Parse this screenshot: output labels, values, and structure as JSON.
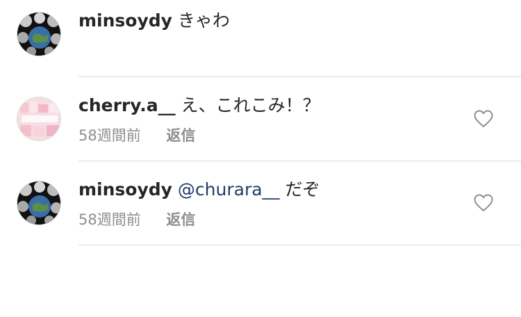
{
  "comments": [
    {
      "username": "minsoydy",
      "mention": "",
      "text": "きゃわ",
      "time": "",
      "reply": "",
      "avatar_icon": "earth-hands-avatar"
    },
    {
      "username": "cherry.a__",
      "mention": "",
      "text": "え、これこみ！？",
      "time": "58週間前",
      "reply": "返信",
      "avatar_icon": "pink-collage-avatar"
    },
    {
      "username": "minsoydy",
      "mention": "@churara__",
      "text": "だぞ",
      "time": "58週間前",
      "reply": "返信",
      "avatar_icon": "earth-hands-avatar"
    }
  ],
  "colors": {
    "username": "#262626",
    "mention": "#1f3c68",
    "meta": "#8e8e8e",
    "divider": "#dbdbdb"
  }
}
